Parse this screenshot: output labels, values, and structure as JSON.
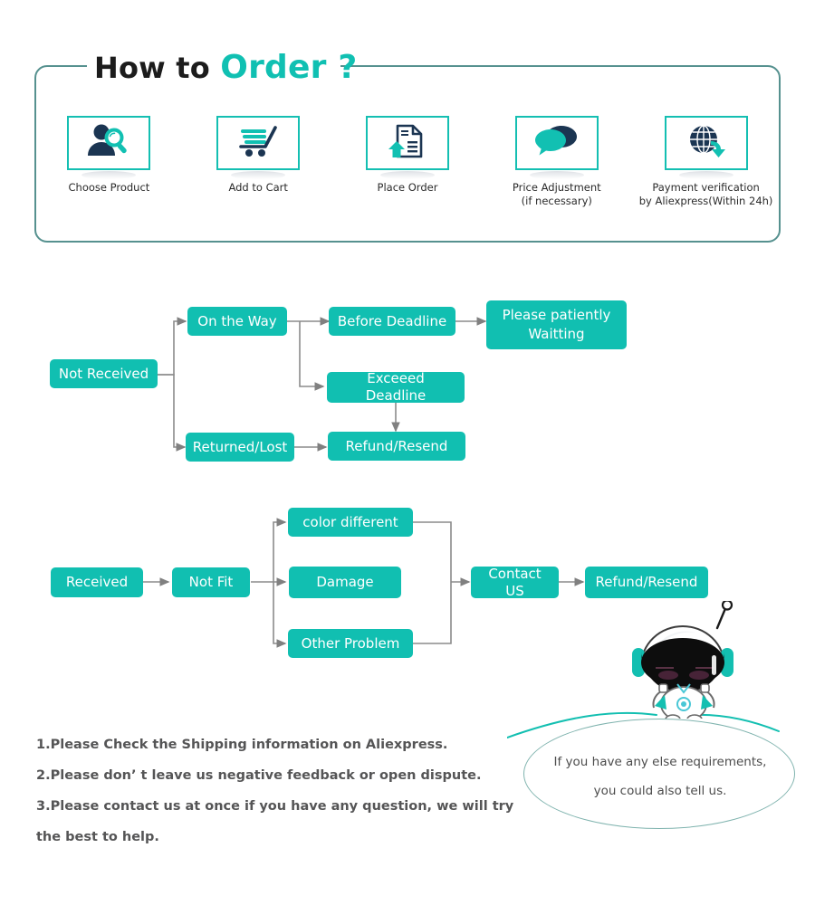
{
  "header": {
    "title_plain": "How to ",
    "title_accent": "Order ?"
  },
  "colors": {
    "teal": "#11bfb1",
    "frame_border": "#56918f",
    "icon_dark": "#1b3552",
    "note_text": "#555556",
    "bubble_border": "#7fb3ae",
    "connector": "#8b8b8b"
  },
  "steps": [
    {
      "icon": "person-search-icon",
      "label_line1": "Choose  Product",
      "label_line2": ""
    },
    {
      "icon": "shopping-cart-icon",
      "label_line1": "Add to Cart",
      "label_line2": ""
    },
    {
      "icon": "document-upload-icon",
      "label_line1": "Place  Order",
      "label_line2": ""
    },
    {
      "icon": "speech-bubbles-icon",
      "label_line1": "Price Adjustment",
      "label_line2": "(if necessary)"
    },
    {
      "icon": "globe-arrow-icon",
      "label_line1": "Payment verification",
      "label_line2": "by Aliexpress(Within 24h)"
    }
  ],
  "flow_not_received": {
    "nodes": [
      {
        "id": "not-received",
        "label": "Not Received"
      },
      {
        "id": "on-the-way",
        "label": "On the Way"
      },
      {
        "id": "returned-lost",
        "label": "Returned/Lost"
      },
      {
        "id": "before-deadline",
        "label": "Before Deadline"
      },
      {
        "id": "exceeed-deadline",
        "label": "Exceeed Deadline"
      },
      {
        "id": "refund-resend",
        "label": "Refund/Resend"
      },
      {
        "id": "please-patiently-waitting",
        "label": "Please patiently Waitting"
      }
    ]
  },
  "flow_received": {
    "nodes": [
      {
        "id": "received",
        "label": "Received"
      },
      {
        "id": "not-fit",
        "label": "Not Fit"
      },
      {
        "id": "color-different",
        "label": "color different"
      },
      {
        "id": "damage",
        "label": "Damage"
      },
      {
        "id": "other-problem",
        "label": "Other Problem"
      },
      {
        "id": "contact-us",
        "label": "Contact US"
      },
      {
        "id": "refund-resend-2",
        "label": "Refund/Resend"
      }
    ]
  },
  "notes": [
    "1.Please Check the Shipping information on Aliexpress.",
    "2.Please don’ t leave us negative feedback or open dispute.",
    "3.Please contact us at once if you have any question, we will try",
    " the best to help."
  ],
  "bubble": {
    "line1": "If you have any else requirements,",
    "line2": "you could also tell us."
  }
}
